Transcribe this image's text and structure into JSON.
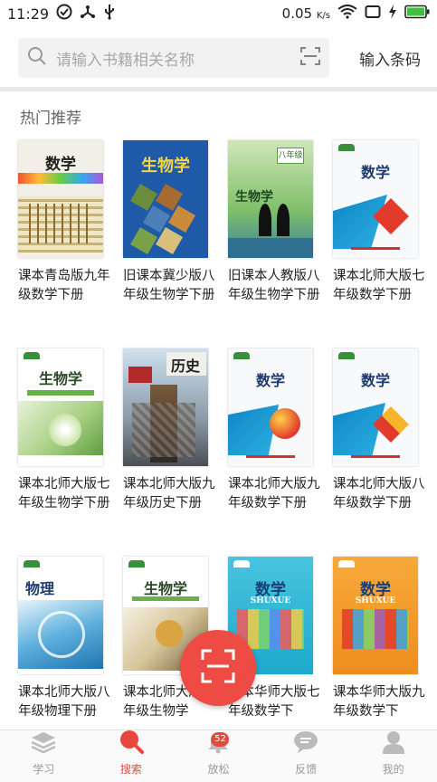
{
  "status_bar": {
    "time": "11:29",
    "speed_value": "0.05",
    "speed_unit": "K/s"
  },
  "search": {
    "placeholder": "请输入书籍相关名称",
    "barcode_label": "输入条码"
  },
  "section": {
    "title": "热门推荐"
  },
  "books": [
    {
      "title": "课本青岛版九年级数学下册",
      "cover_text": "数学",
      "cover_style": "qingdao-math"
    },
    {
      "title": "旧课本冀少版八年级生物学下册",
      "cover_text": "生物学",
      "cover_style": "jishao-bio"
    },
    {
      "title": "旧课本人教版八年级生物学下册",
      "cover_text": "生物学",
      "cover_badge": "八年级",
      "cover_style": "renjiao-bio"
    },
    {
      "title": "课本北师大版七年级数学下册",
      "cover_text": "数学",
      "cover_style": "bsd-math-blue"
    },
    {
      "title": "课本北师大版七年级生物学下册",
      "cover_text": "生物学",
      "cover_style": "bsd-bio-green"
    },
    {
      "title": "课本北师大版九年级历史下册",
      "cover_text": "历史",
      "cover_style": "bsd-history"
    },
    {
      "title": "课本北师大版九年级数学下册",
      "cover_text": "数学",
      "cover_style": "bsd-math-blue2"
    },
    {
      "title": "课本北师大版八年级数学下册",
      "cover_text": "数学",
      "cover_style": "bsd-math-blue3"
    },
    {
      "title": "课本北师大版八年级物理下册",
      "cover_text": "物理",
      "cover_style": "bsd-physics"
    },
    {
      "title": "课本北师大版八年级生物学",
      "cover_text": "生物学",
      "cover_style": "bsd-bio-2"
    },
    {
      "title": "课本华师大版七年级数学下",
      "cover_text": "数学",
      "cover_sub": "SHUXUE",
      "cover_style": "hsd-math-cyan"
    },
    {
      "title": "课本华师大版九年级数学下",
      "cover_text": "数学",
      "cover_sub": "SHUXUE",
      "cover_style": "hsd-math-orange"
    }
  ],
  "bottom_nav": [
    {
      "label": "学习",
      "icon": "layers-icon"
    },
    {
      "label": "搜索",
      "icon": "search-icon",
      "active": true
    },
    {
      "label": "放松",
      "icon": "bell-icon",
      "badge": "52"
    },
    {
      "label": "反馈",
      "icon": "chat-bubble-icon"
    },
    {
      "label": "我的",
      "icon": "person-icon"
    }
  ],
  "colors": {
    "accent": "#e8473f",
    "fab": "#ef4b45"
  }
}
